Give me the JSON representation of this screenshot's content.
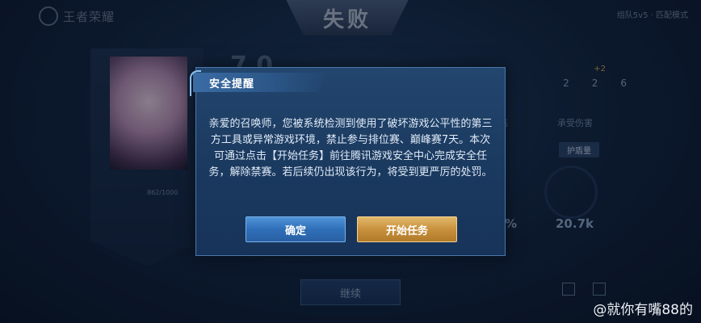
{
  "background": {
    "game_logo": "王者荣耀",
    "result_banner": "失败",
    "mode_label": "组队5v5 · 匹配模式",
    "continue_label": "继续",
    "hero_level_text": "862/1000",
    "stats": {
      "deaths": "2",
      "assists_a": "2",
      "assists_b": "6"
    },
    "exp_badge": "+2",
    "col_title_a": "结",
    "col_title_b": "承受伤害",
    "tag_label": "护盾量",
    "value_big": "20.7k",
    "pct_value": "%"
  },
  "dialog": {
    "title": "安全提醒",
    "body": "亲爱的召唤师，您被系统检测到使用了破坏游戏公平性的第三方工具或异常游戏环境，禁止参与排位赛、巅峰赛7天。本次可通过点击【开始任务】前往腾讯游戏安全中心完成安全任务，解除禁赛。若后续仍出现该行为，将受到更严厉的处罚。",
    "confirm_label": "确定",
    "start_label": "开始任务"
  },
  "watermark": {
    "text": "@就你有嘴88的"
  },
  "colors": {
    "confirm": "#2f6fb8",
    "start": "#c8913d",
    "dialog_bg": "#1b3a60"
  }
}
